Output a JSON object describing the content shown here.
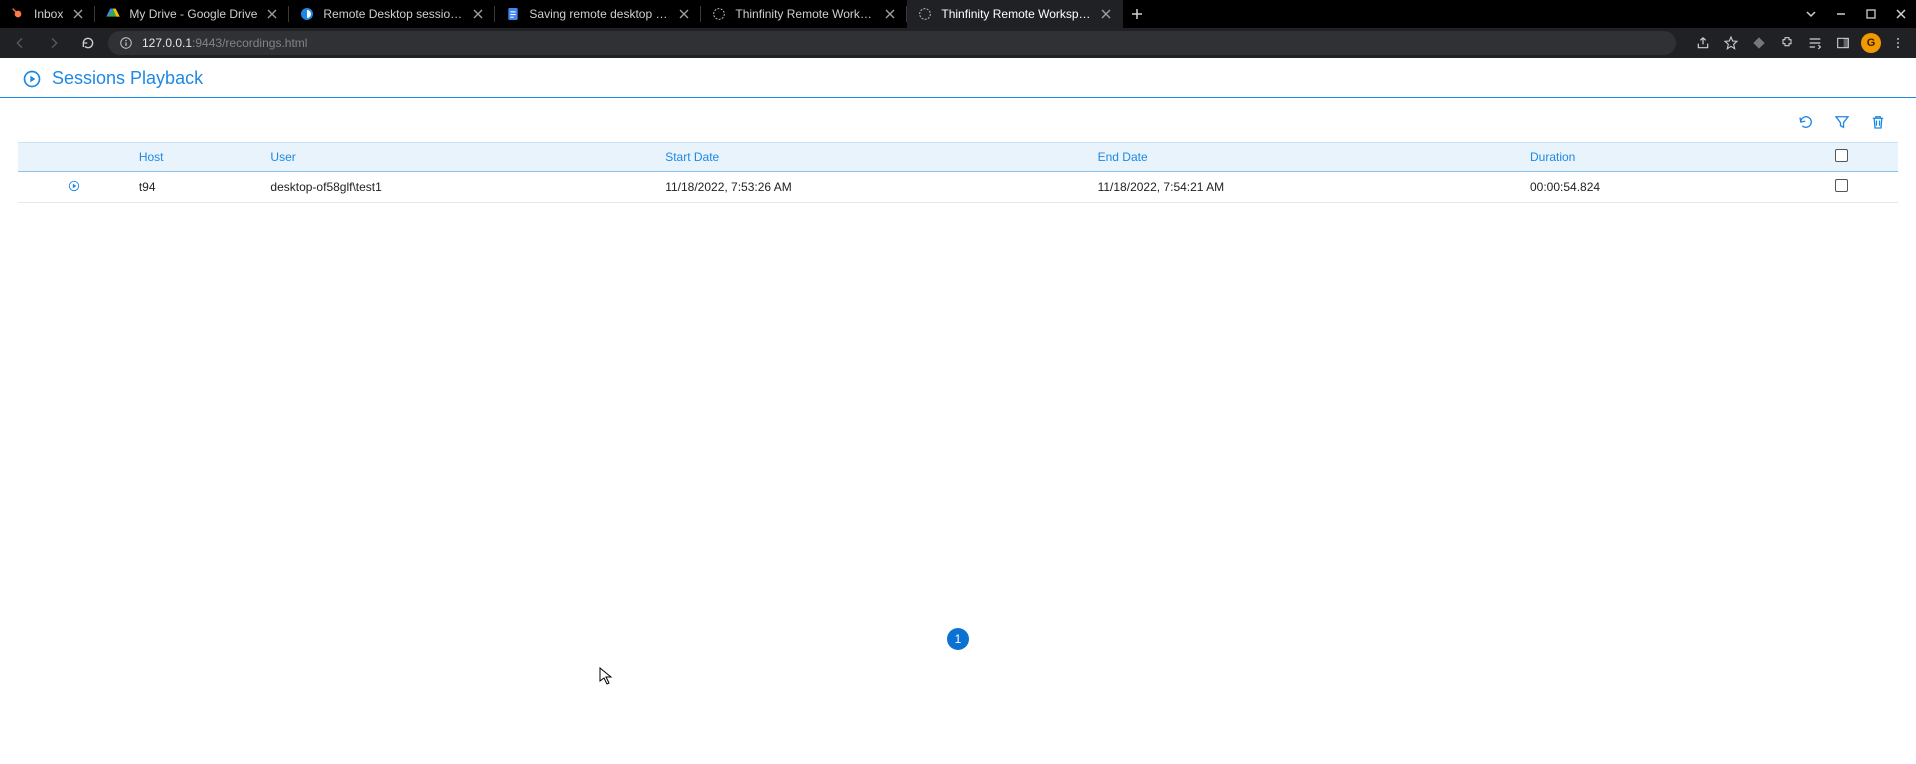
{
  "browser": {
    "tabs": [
      {
        "title": "Inbox"
      },
      {
        "title": "My Drive - Google Drive"
      },
      {
        "title": "Remote Desktop session recordin"
      },
      {
        "title": "Saving remote desktop sessions"
      },
      {
        "title": "Thinfinity Remote Workspace"
      },
      {
        "title": "Thinfinity Remote Workspace - S"
      }
    ],
    "active_tab_index": 5,
    "url_bright": "127.0.0.1",
    "url_faded": ":9443/recordings.html",
    "avatar_letter": "G"
  },
  "page": {
    "header_title": "Sessions Playback",
    "columns": {
      "host": "Host",
      "user": "User",
      "start": "Start Date",
      "end": "End Date",
      "duration": "Duration"
    },
    "rows": [
      {
        "host": "t94",
        "user": "desktop-of58glf\\test1",
        "start": "11/18/2022, 7:53:26 AM",
        "end": "11/18/2022, 7:54:21 AM",
        "duration": "00:00:54.824"
      }
    ],
    "pager_current": "1"
  }
}
